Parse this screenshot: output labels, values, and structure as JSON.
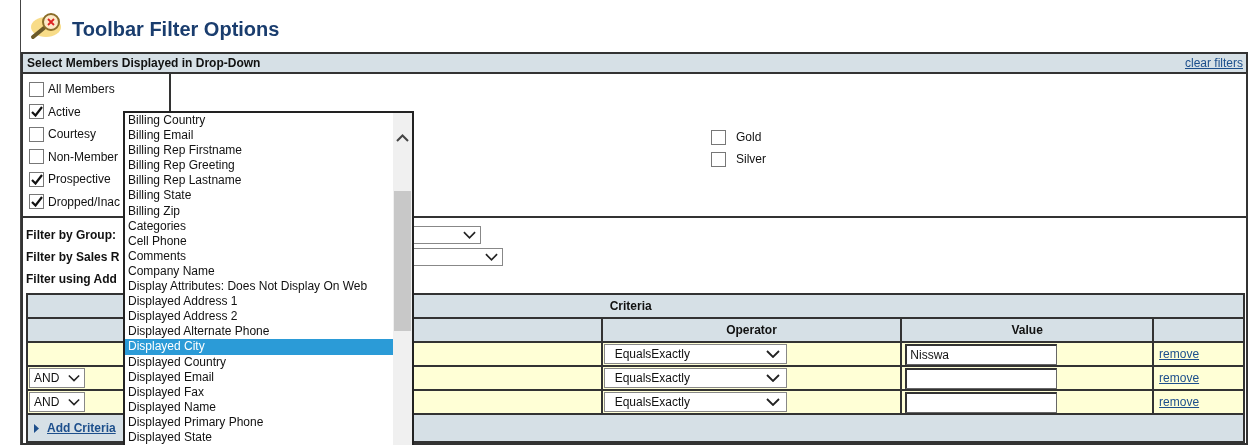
{
  "title": "Toolbar Filter Options",
  "members_panel": {
    "header": "Select Members Displayed in Drop-Down",
    "clear_link": "clear filters",
    "statuses": [
      {
        "label": "All Members",
        "checked": false
      },
      {
        "label": "Active",
        "checked": true
      },
      {
        "label": "Courtesy",
        "checked": false
      },
      {
        "label": "Non-Member",
        "checked": false
      },
      {
        "label": "Prospective",
        "checked": true
      },
      {
        "label": "Dropped/Inac",
        "checked": true
      }
    ],
    "levels": [
      {
        "label": "Gold",
        "checked": false
      },
      {
        "label": "Silver",
        "checked": false
      }
    ]
  },
  "filters": {
    "group_label": "Filter by Group:",
    "sales_rep_label": "Filter by Sales R",
    "additional_label": "Filter using Add"
  },
  "criteria": {
    "title": "Criteria",
    "columns": [
      "Operator",
      "Value"
    ],
    "rows": [
      {
        "operator": "EqualsExactly",
        "value": "Nisswa",
        "remove": "remove"
      },
      {
        "conjunction": "AND",
        "operator": "EqualsExactly",
        "remove": "remove"
      },
      {
        "conjunction": "AND",
        "operator": "EqualsExactly",
        "remove": "remove"
      }
    ],
    "add_link": "Add Criteria"
  },
  "field_dropdown": {
    "options": [
      {
        "label": "Billing Country",
        "selected": false
      },
      {
        "label": "Billing Email",
        "selected": false
      },
      {
        "label": "Billing Rep Firstname",
        "selected": false
      },
      {
        "label": "Billing Rep Greeting",
        "selected": false
      },
      {
        "label": "Billing Rep Lastname",
        "selected": false
      },
      {
        "label": "Billing State",
        "selected": false
      },
      {
        "label": "Billing Zip",
        "selected": false
      },
      {
        "label": "Categories",
        "selected": false
      },
      {
        "label": "Cell Phone",
        "selected": false
      },
      {
        "label": "Comments",
        "selected": false
      },
      {
        "label": "Company Name",
        "selected": false
      },
      {
        "label": "Display Attributes: Does Not Display On Web",
        "selected": false
      },
      {
        "label": "Displayed Address 1",
        "selected": false
      },
      {
        "label": "Displayed Address 2",
        "selected": false
      },
      {
        "label": "Displayed Alternate Phone",
        "selected": false
      },
      {
        "label": "Displayed City",
        "selected": true
      },
      {
        "label": "Displayed Country",
        "selected": false
      },
      {
        "label": "Displayed Email",
        "selected": false
      },
      {
        "label": "Displayed Fax",
        "selected": false
      },
      {
        "label": "Displayed Name",
        "selected": false
      },
      {
        "label": "Displayed Primary Phone",
        "selected": false
      },
      {
        "label": "Displayed State",
        "selected": false
      }
    ]
  }
}
